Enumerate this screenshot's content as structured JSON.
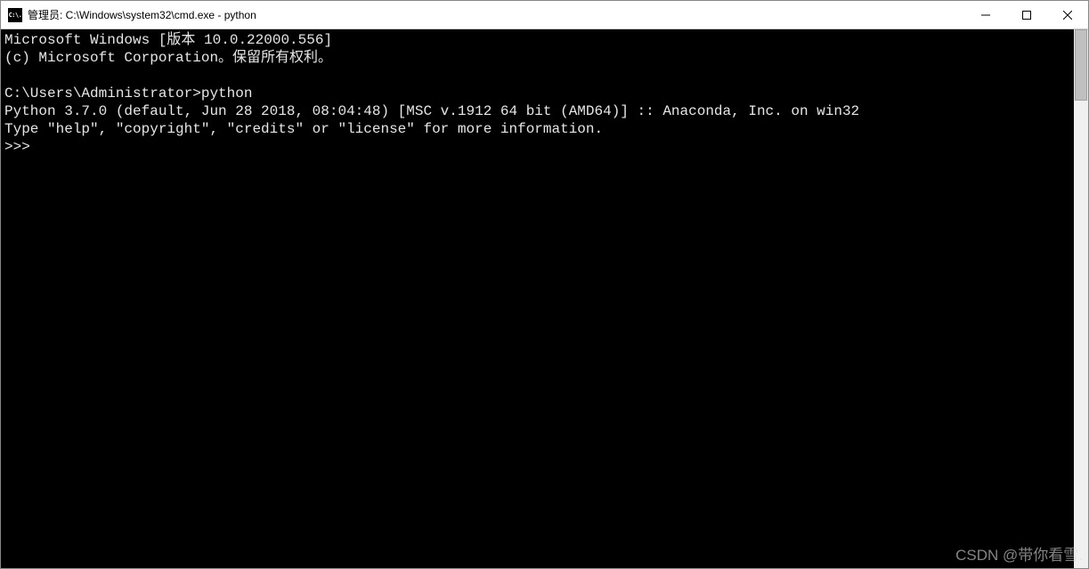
{
  "window": {
    "app_icon_text": "C:\\.",
    "title": "管理员: C:\\Windows\\system32\\cmd.exe - python"
  },
  "terminal": {
    "line1": "Microsoft Windows [版本 10.0.22000.556]",
    "line2": "(c) Microsoft Corporation。保留所有权利。",
    "blank1": "",
    "prompt_path": "C:\\Users\\Administrator>",
    "prompt_cmd": "python",
    "python_version": "Python 3.7.0 (default, Jun 28 2018, 08:04:48) [MSC v.1912 64 bit (AMD64)] :: Anaconda, Inc. on win32",
    "python_help": "Type \"help\", \"copyright\", \"credits\" or \"license\" for more information.",
    "repl_prompt": ">>> "
  },
  "watermark": "CSDN @带你看雪."
}
